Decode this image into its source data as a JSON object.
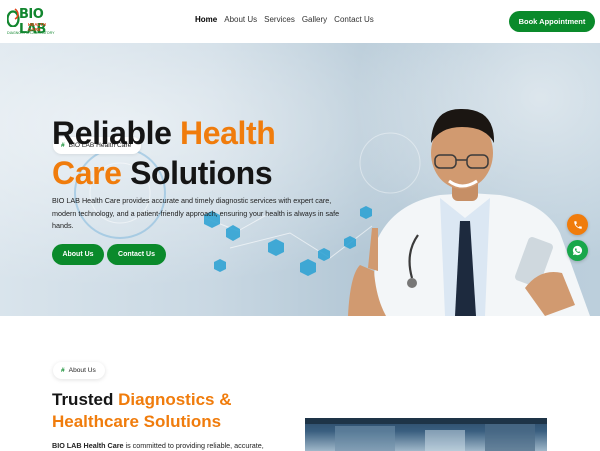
{
  "header": {
    "logo": {
      "brand": "BIO LAB",
      "sub": "HEALTH CARE",
      "tagline": "DIAGNOSTIC LABORATORY"
    },
    "nav": [
      "Home",
      "About Us",
      "Services",
      "Gallery",
      "Contact Us"
    ],
    "active_nav": "Home",
    "cta": "Book Appointment"
  },
  "hero": {
    "badge": "BIO LAB Health Care",
    "title_line1_dark": "Reliable ",
    "title_line1_orange": "Health",
    "title_line2_orange": "Care ",
    "title_line2_dark": "Solutions",
    "description": "BIO LAB Health Care provides accurate and timely diagnostic services with expert care, modern technology, and a patient-friendly approach, ensuring your health is always in safe hands.",
    "buttons": {
      "about": "About Us",
      "contact": "Contact Us"
    }
  },
  "floating": {
    "phone_icon": "phone-icon",
    "whatsapp_icon": "whatsapp-icon"
  },
  "about": {
    "badge": "About Us",
    "title_dark": "Trusted ",
    "title_orange_1": "Diagnostics &",
    "title_orange_2": "Healthcare Solutions",
    "text_bold": "BIO LAB Health Care",
    "text_rest": " is committed to providing reliable, accurate,"
  },
  "colors": {
    "brand_green": "#0a8a2b",
    "accent_orange": "#f07c0c"
  }
}
